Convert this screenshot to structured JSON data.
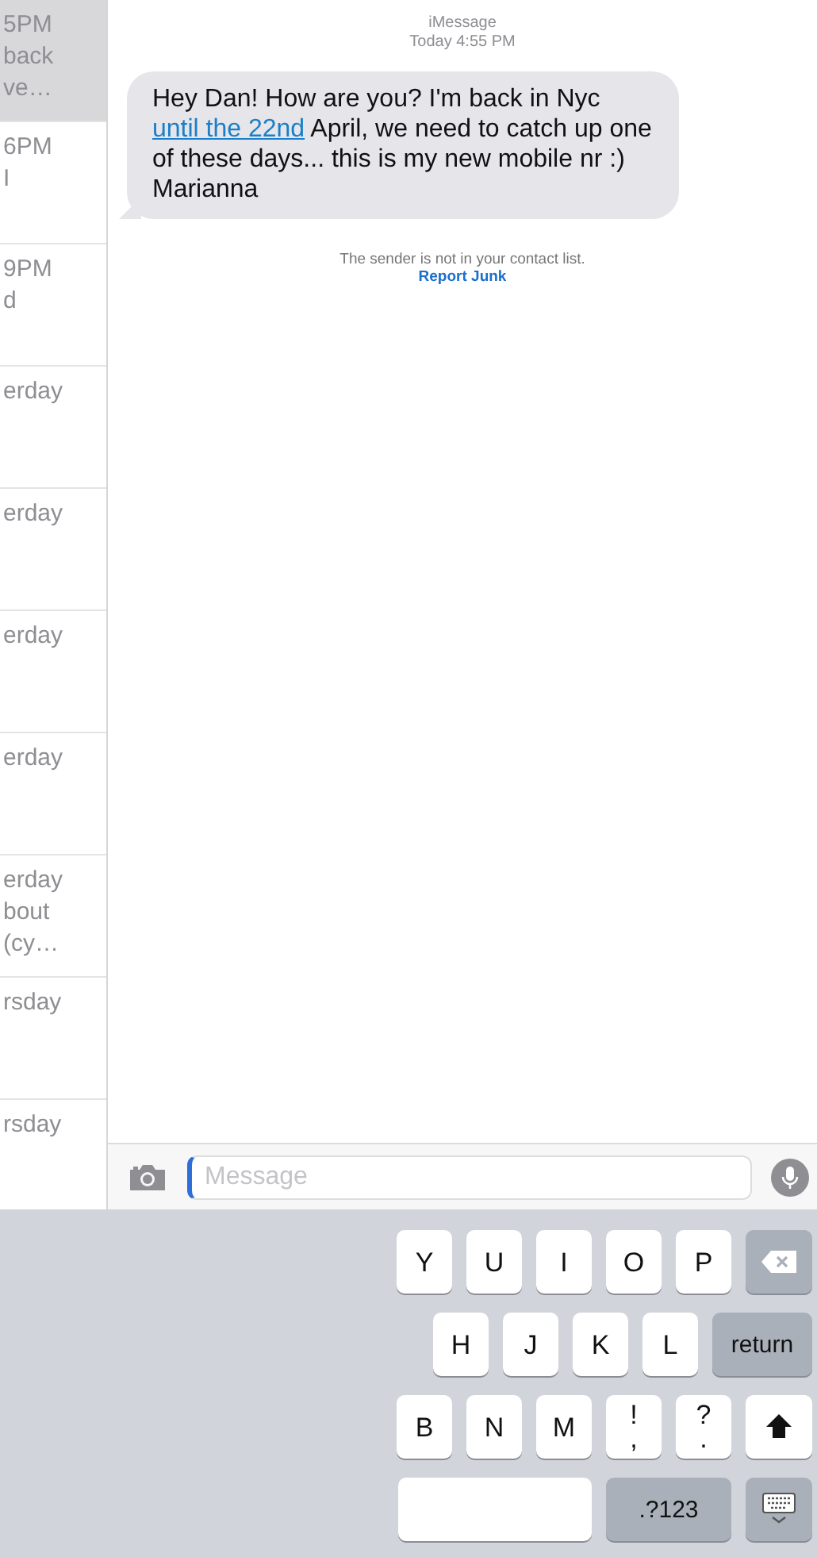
{
  "conversations": [
    {
      "lines": [
        "5PM",
        "back",
        "ve…"
      ],
      "selected": true
    },
    {
      "lines": [
        "6PM",
        "I"
      ],
      "selected": false
    },
    {
      "lines": [
        "9PM",
        "d"
      ],
      "selected": false
    },
    {
      "lines": [
        "erday"
      ],
      "selected": false
    },
    {
      "lines": [
        "erday"
      ],
      "selected": false
    },
    {
      "lines": [
        "erday"
      ],
      "selected": false
    },
    {
      "lines": [
        "erday"
      ],
      "selected": false
    },
    {
      "lines": [
        "erday",
        "bout",
        "(cy…"
      ],
      "selected": false
    },
    {
      "lines": [
        "rsday"
      ],
      "selected": false
    },
    {
      "lines": [
        "rsday"
      ],
      "selected": false
    }
  ],
  "thread": {
    "service": "iMessage",
    "timestamp": "Today 4:55 PM",
    "message": [
      {
        "kind": "text",
        "text": "Hey Dan! How are you? I'm back in Nyc "
      },
      {
        "kind": "link",
        "text": "until the 22nd"
      },
      {
        "kind": "text",
        "text": " April, we need to catch up one of these days... this is my new mobile nr :) Marianna"
      }
    ],
    "notice": "The sender is not in your contact list.",
    "report": "Report Junk"
  },
  "composer": {
    "placeholder": "Message"
  },
  "keyboard": [
    [
      {
        "kind": "letter",
        "label": "Y"
      },
      {
        "kind": "letter",
        "label": "U"
      },
      {
        "kind": "letter",
        "label": "I"
      },
      {
        "kind": "letter",
        "label": "O"
      },
      {
        "kind": "letter",
        "label": "P"
      },
      {
        "kind": "backspace"
      }
    ],
    [
      {
        "kind": "letter",
        "label": "H"
      },
      {
        "kind": "letter",
        "label": "J"
      },
      {
        "kind": "letter",
        "label": "K"
      },
      {
        "kind": "letter",
        "label": "L"
      },
      {
        "kind": "return",
        "label": "return"
      }
    ],
    [
      {
        "kind": "letter",
        "label": "B"
      },
      {
        "kind": "letter",
        "label": "N"
      },
      {
        "kind": "letter",
        "label": "M"
      },
      {
        "kind": "punct",
        "label": "!",
        "sub": ","
      },
      {
        "kind": "punct",
        "label": "?",
        "sub": "."
      },
      {
        "kind": "shift"
      }
    ],
    [
      {
        "kind": "space"
      },
      {
        "kind": "mode",
        "label": ".?123"
      },
      {
        "kind": "dismiss"
      }
    ]
  ]
}
